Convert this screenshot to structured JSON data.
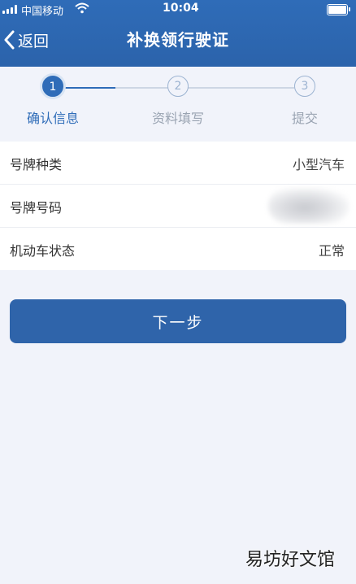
{
  "status_bar": {
    "carrier": "中国移动",
    "time": "10:04"
  },
  "nav": {
    "back_label": "返回",
    "title": "补换领行驶证"
  },
  "steps": [
    {
      "number": "1",
      "label": "确认信息",
      "active": true
    },
    {
      "number": "2",
      "label": "资料填写",
      "active": false
    },
    {
      "number": "3",
      "label": "提交",
      "active": false
    }
  ],
  "info_rows": [
    {
      "label": "号牌种类",
      "value": "小型汽车"
    },
    {
      "label": "号牌号码",
      "value": ""
    },
    {
      "label": "机动车状态",
      "value": "正常"
    }
  ],
  "next_button_label": "下一步",
  "watermark": "易坊好文馆",
  "colors": {
    "primary": "#2f6cb8",
    "background": "#f1f3fa",
    "inactive_step": "#9cb3d1"
  }
}
